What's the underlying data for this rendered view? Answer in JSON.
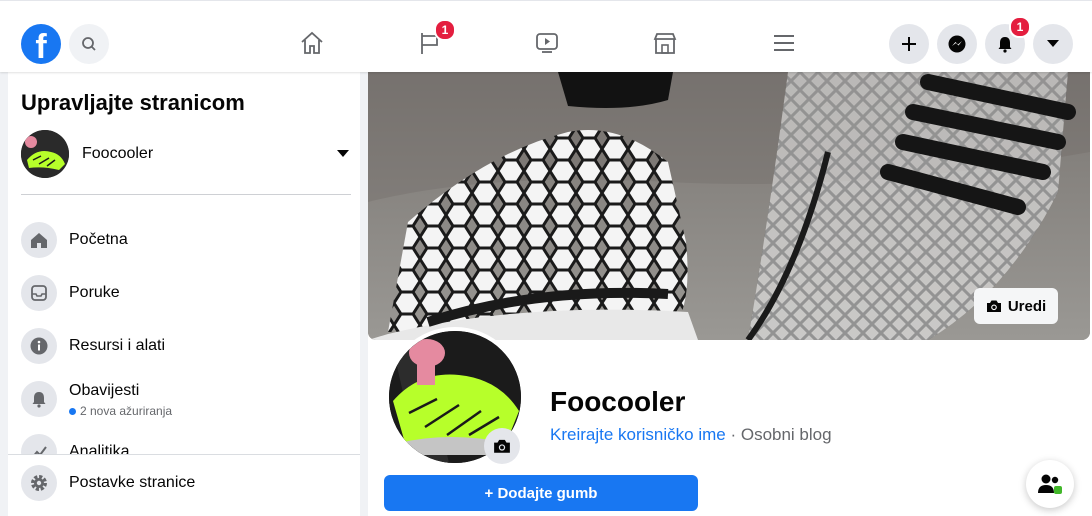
{
  "header": {
    "logo_letter": "f",
    "nav_badges": {
      "pages": "1",
      "notifications": "1"
    },
    "icons": [
      "facebook-logo",
      "search-icon",
      "home-icon",
      "flag-icon",
      "video-icon",
      "marketplace-icon",
      "menu-icon",
      "plus-icon",
      "messenger-icon",
      "bell-icon",
      "caret-down-icon"
    ]
  },
  "sidebar": {
    "title": "Upravljajte stranicom",
    "page_name": "Foocooler",
    "items": [
      {
        "label": "Početna",
        "icon": "home-icon"
      },
      {
        "label": "Poruke",
        "icon": "inbox-icon"
      },
      {
        "label": "Resursi i alati",
        "icon": "info-icon"
      },
      {
        "label": "Obavijesti",
        "sub": "2 nova ažuriranja",
        "icon": "bell-icon"
      },
      {
        "label": "Analitika",
        "icon": "analytics-icon"
      }
    ],
    "settings_label": "Postavke stranice"
  },
  "main": {
    "edit_cover_label": "Uredi",
    "page_title": "Foocooler",
    "username_link": "Kreirajte korisničko ime",
    "separator": " · ",
    "category": "Osobni blog",
    "add_button_label": "+ Dodajte gumb"
  },
  "colors": {
    "accent": "#1877f2",
    "badge": "#e41e3f",
    "neon": "#b7ff2a"
  }
}
